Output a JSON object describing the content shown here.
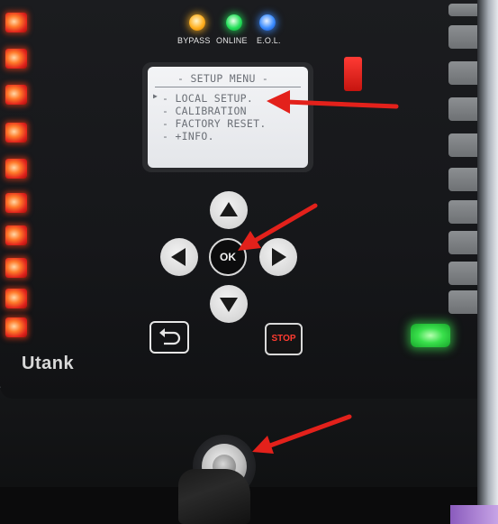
{
  "status_indicators": [
    {
      "label": "BYPASS",
      "color": "#ffb020"
    },
    {
      "label": "ONLINE",
      "color": "#24e05a"
    },
    {
      "label": "E.O.L.",
      "color": "#3b8cff"
    }
  ],
  "lcd": {
    "title": "- SETUP MENU -",
    "items": [
      {
        "label": "- LOCAL SETUP.",
        "selected": true,
        "cursor": "▶"
      },
      {
        "label": "- CALIBRATION",
        "selected": false
      },
      {
        "label": "- FACTORY RESET.",
        "selected": false
      },
      {
        "label": "- +INFO.",
        "selected": false
      }
    ]
  },
  "keypad": {
    "up": "arrow-up-icon",
    "down": "arrow-down-icon",
    "left": "arrow-left-icon",
    "right": "arrow-right-icon",
    "ok_label": "OK",
    "back": "return-icon",
    "stop_label": "STOP"
  },
  "brand": {
    "logo_text": "Utank"
  },
  "colors": {
    "annotation_arrow": "#e3211b",
    "stop_text": "#ff3b30",
    "led_red": "#e0231c",
    "led_green": "#39e04b"
  }
}
